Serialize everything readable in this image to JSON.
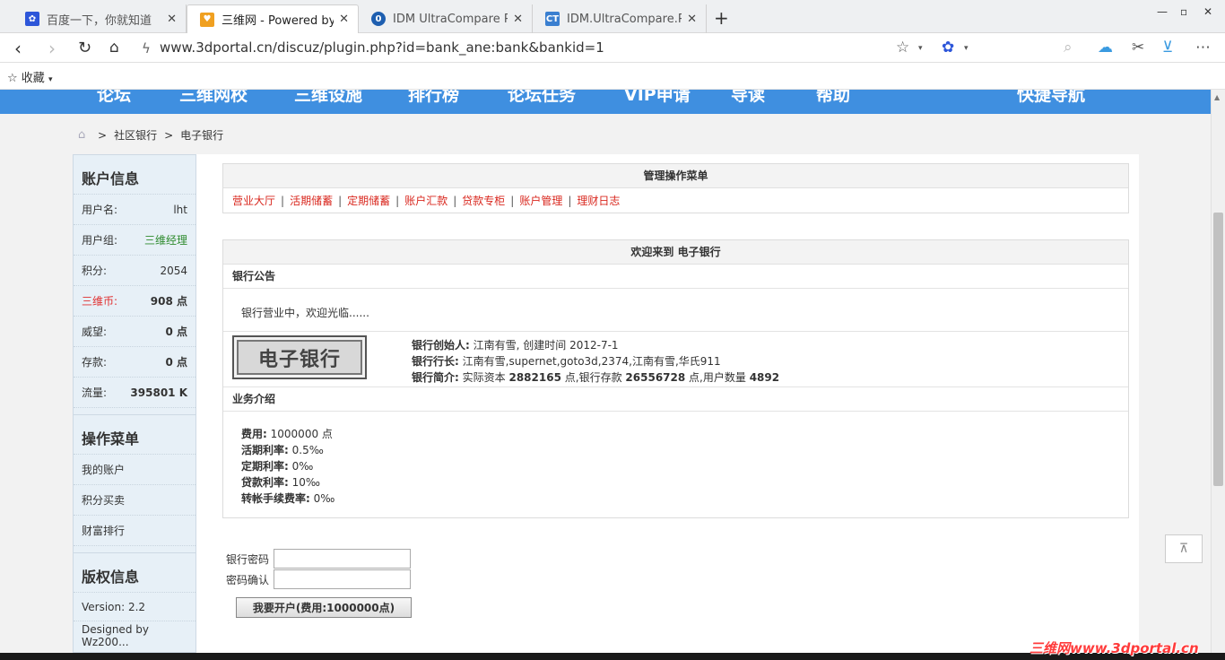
{
  "browser": {
    "tabs": [
      {
        "title": "百度一下，你就知道",
        "icon_color": "#2d56d9"
      },
      {
        "title": "三维网 - Powered by D",
        "icon_color": "#f0a020"
      },
      {
        "title": "IDM UltraCompare Pr",
        "icon_color": "#1e5fb0"
      },
      {
        "title": "IDM.UltraCompare.Pr",
        "icon_color": "#3a7fd0"
      }
    ],
    "url": "www.3dportal.cn/discuz/plugin.php?id=bank_ane:bank&bankid=1",
    "bookmark_label": "收藏"
  },
  "site_nav": [
    "论坛",
    "三维网校",
    "三维设施",
    "排行榜",
    "论坛任务",
    "VIP申请",
    "导读",
    "帮助",
    "快捷导航"
  ],
  "breadcrumb": {
    "sep": ">",
    "items": [
      "社区银行",
      "电子银行"
    ]
  },
  "sidebar": {
    "account_title": "账户信息",
    "rows": [
      {
        "k": "用户名:",
        "v": "lht"
      },
      {
        "k": "用户组:",
        "v": "三维经理"
      },
      {
        "k": "积分:",
        "v": "2054"
      },
      {
        "k": "三维币:",
        "v": "908 点"
      },
      {
        "k": "威望:",
        "v": "0 点"
      },
      {
        "k": "存款:",
        "v": "0 点"
      },
      {
        "k": "流量:",
        "v": "395801 K"
      }
    ],
    "menu_title": "操作菜单",
    "menu": [
      "我的账户",
      "积分买卖",
      "财富排行"
    ],
    "copyright_title": "版权信息",
    "copyright": [
      "Version: 2.2",
      "Designed by Wz200..."
    ]
  },
  "admin_menu": {
    "title": "管理操作菜单",
    "links": [
      "营业大厅",
      "活期储蓄",
      "定期储蓄",
      "账户汇款",
      "贷款专柜",
      "账户管理",
      "理财日志"
    ]
  },
  "welcome": {
    "title": "欢迎来到 电子银行",
    "notice_head": "银行公告",
    "notice": "银行营业中，欢迎光临......",
    "logo_text": "电子银行",
    "founder_label": "银行创始人:",
    "founder": "江南有雪, 创建时间 2012-7-1",
    "president_label": "银行行长:",
    "president": "江南有雪,supernet,goto3d,2374,江南有雪,华氏911",
    "intro_label": "银行简介:",
    "intro_capital_label": "实际资本",
    "intro_capital": "2882165",
    "intro_deposit_label": "点,银行存款",
    "intro_deposit": "26556728",
    "intro_users_label": "点,用户数量",
    "intro_users": "4892",
    "biz_head": "业务介绍",
    "biz": [
      {
        "k": "费用:",
        "v": "1000000 点"
      },
      {
        "k": "活期利率:",
        "v": "0.5‰"
      },
      {
        "k": "定期利率:",
        "v": "0‰"
      },
      {
        "k": "贷款利率:",
        "v": "10‰"
      },
      {
        "k": "转帐手续费率:",
        "v": "0‰"
      }
    ]
  },
  "form": {
    "password_label": "银行密码",
    "confirm_label": "密码确认",
    "submit": "我要开户(费用:1000000点)"
  },
  "watermark": "三维网www.3dportal.cn"
}
